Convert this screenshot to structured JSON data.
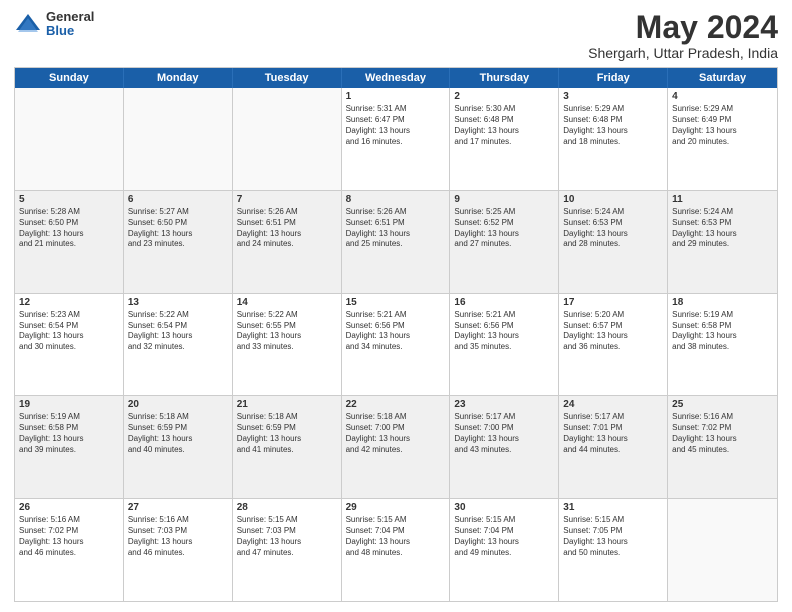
{
  "logo": {
    "general": "General",
    "blue": "Blue"
  },
  "title": "May 2024",
  "subtitle": "Shergarh, Uttar Pradesh, India",
  "days": [
    "Sunday",
    "Monday",
    "Tuesday",
    "Wednesday",
    "Thursday",
    "Friday",
    "Saturday"
  ],
  "weeks": [
    [
      {
        "day": "",
        "info": ""
      },
      {
        "day": "",
        "info": ""
      },
      {
        "day": "",
        "info": ""
      },
      {
        "day": "1",
        "info": "Sunrise: 5:31 AM\nSunset: 6:47 PM\nDaylight: 13 hours\nand 16 minutes."
      },
      {
        "day": "2",
        "info": "Sunrise: 5:30 AM\nSunset: 6:48 PM\nDaylight: 13 hours\nand 17 minutes."
      },
      {
        "day": "3",
        "info": "Sunrise: 5:29 AM\nSunset: 6:48 PM\nDaylight: 13 hours\nand 18 minutes."
      },
      {
        "day": "4",
        "info": "Sunrise: 5:29 AM\nSunset: 6:49 PM\nDaylight: 13 hours\nand 20 minutes."
      }
    ],
    [
      {
        "day": "5",
        "info": "Sunrise: 5:28 AM\nSunset: 6:50 PM\nDaylight: 13 hours\nand 21 minutes."
      },
      {
        "day": "6",
        "info": "Sunrise: 5:27 AM\nSunset: 6:50 PM\nDaylight: 13 hours\nand 23 minutes."
      },
      {
        "day": "7",
        "info": "Sunrise: 5:26 AM\nSunset: 6:51 PM\nDaylight: 13 hours\nand 24 minutes."
      },
      {
        "day": "8",
        "info": "Sunrise: 5:26 AM\nSunset: 6:51 PM\nDaylight: 13 hours\nand 25 minutes."
      },
      {
        "day": "9",
        "info": "Sunrise: 5:25 AM\nSunset: 6:52 PM\nDaylight: 13 hours\nand 27 minutes."
      },
      {
        "day": "10",
        "info": "Sunrise: 5:24 AM\nSunset: 6:53 PM\nDaylight: 13 hours\nand 28 minutes."
      },
      {
        "day": "11",
        "info": "Sunrise: 5:24 AM\nSunset: 6:53 PM\nDaylight: 13 hours\nand 29 minutes."
      }
    ],
    [
      {
        "day": "12",
        "info": "Sunrise: 5:23 AM\nSunset: 6:54 PM\nDaylight: 13 hours\nand 30 minutes."
      },
      {
        "day": "13",
        "info": "Sunrise: 5:22 AM\nSunset: 6:54 PM\nDaylight: 13 hours\nand 32 minutes."
      },
      {
        "day": "14",
        "info": "Sunrise: 5:22 AM\nSunset: 6:55 PM\nDaylight: 13 hours\nand 33 minutes."
      },
      {
        "day": "15",
        "info": "Sunrise: 5:21 AM\nSunset: 6:56 PM\nDaylight: 13 hours\nand 34 minutes."
      },
      {
        "day": "16",
        "info": "Sunrise: 5:21 AM\nSunset: 6:56 PM\nDaylight: 13 hours\nand 35 minutes."
      },
      {
        "day": "17",
        "info": "Sunrise: 5:20 AM\nSunset: 6:57 PM\nDaylight: 13 hours\nand 36 minutes."
      },
      {
        "day": "18",
        "info": "Sunrise: 5:19 AM\nSunset: 6:58 PM\nDaylight: 13 hours\nand 38 minutes."
      }
    ],
    [
      {
        "day": "19",
        "info": "Sunrise: 5:19 AM\nSunset: 6:58 PM\nDaylight: 13 hours\nand 39 minutes."
      },
      {
        "day": "20",
        "info": "Sunrise: 5:18 AM\nSunset: 6:59 PM\nDaylight: 13 hours\nand 40 minutes."
      },
      {
        "day": "21",
        "info": "Sunrise: 5:18 AM\nSunset: 6:59 PM\nDaylight: 13 hours\nand 41 minutes."
      },
      {
        "day": "22",
        "info": "Sunrise: 5:18 AM\nSunset: 7:00 PM\nDaylight: 13 hours\nand 42 minutes."
      },
      {
        "day": "23",
        "info": "Sunrise: 5:17 AM\nSunset: 7:00 PM\nDaylight: 13 hours\nand 43 minutes."
      },
      {
        "day": "24",
        "info": "Sunrise: 5:17 AM\nSunset: 7:01 PM\nDaylight: 13 hours\nand 44 minutes."
      },
      {
        "day": "25",
        "info": "Sunrise: 5:16 AM\nSunset: 7:02 PM\nDaylight: 13 hours\nand 45 minutes."
      }
    ],
    [
      {
        "day": "26",
        "info": "Sunrise: 5:16 AM\nSunset: 7:02 PM\nDaylight: 13 hours\nand 46 minutes."
      },
      {
        "day": "27",
        "info": "Sunrise: 5:16 AM\nSunset: 7:03 PM\nDaylight: 13 hours\nand 46 minutes."
      },
      {
        "day": "28",
        "info": "Sunrise: 5:15 AM\nSunset: 7:03 PM\nDaylight: 13 hours\nand 47 minutes."
      },
      {
        "day": "29",
        "info": "Sunrise: 5:15 AM\nSunset: 7:04 PM\nDaylight: 13 hours\nand 48 minutes."
      },
      {
        "day": "30",
        "info": "Sunrise: 5:15 AM\nSunset: 7:04 PM\nDaylight: 13 hours\nand 49 minutes."
      },
      {
        "day": "31",
        "info": "Sunrise: 5:15 AM\nSunset: 7:05 PM\nDaylight: 13 hours\nand 50 minutes."
      },
      {
        "day": "",
        "info": ""
      }
    ]
  ]
}
